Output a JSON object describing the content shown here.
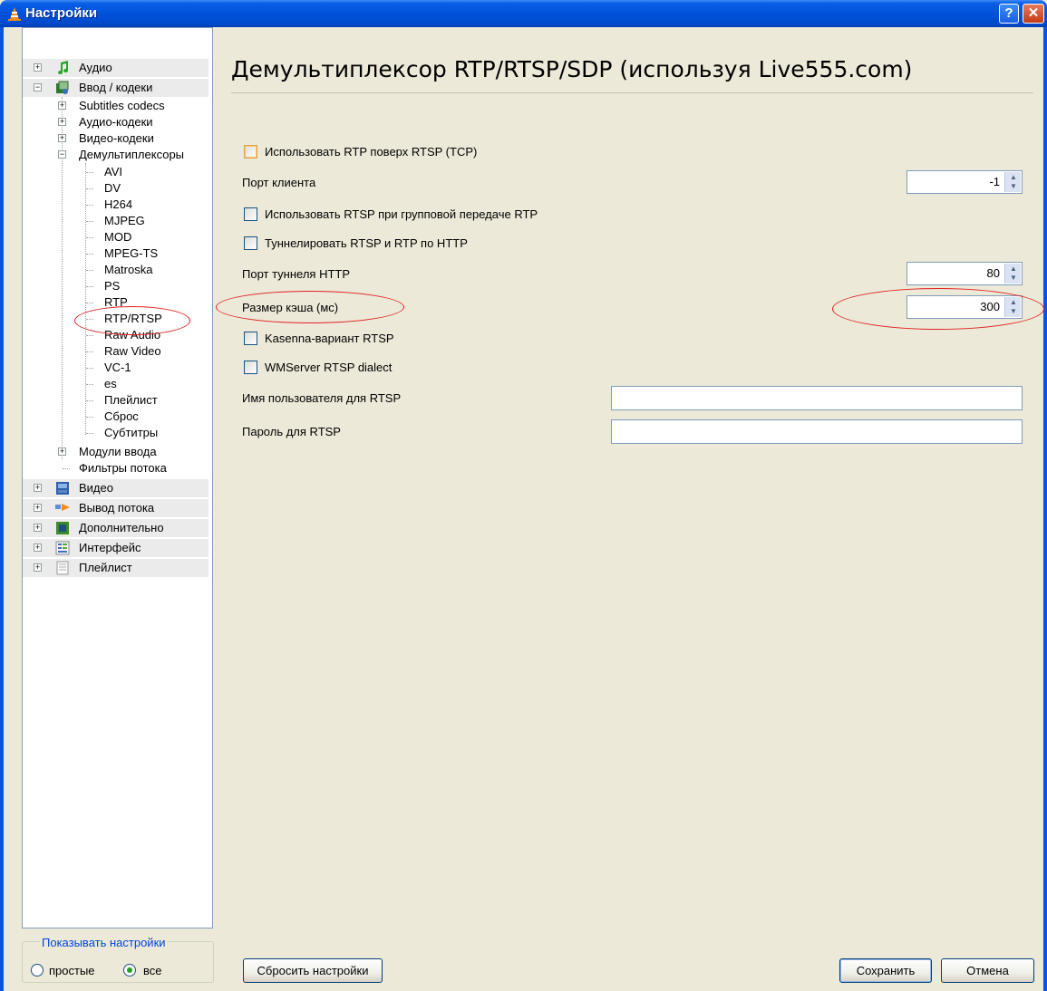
{
  "window": {
    "title": "Настройки",
    "help_glyph": "?",
    "close_glyph": "✕"
  },
  "tree": {
    "audio": "Аудио",
    "input_codecs": "Ввод / кодеки",
    "subtitles_codecs": "Subtitles codecs",
    "audio_codecs": "Аудио-кодеки",
    "video_codecs": "Видео-кодеки",
    "demuxers": "Демультиплексоры",
    "demuxer_items": [
      "AVI",
      "DV",
      "H264",
      "MJPEG",
      "MOD",
      "MPEG-TS",
      "Matroska",
      "PS",
      "RTP",
      "RTP/RTSP",
      "Raw Audio",
      "Raw Video",
      "VC-1",
      "es",
      "Плейлист",
      "Сброс",
      "Субтитры"
    ],
    "input_modules": "Модули ввода",
    "stream_filters": "Фильтры потока",
    "video": "Видео",
    "stream_output": "Вывод потока",
    "advanced": "Дополнительно",
    "interface": "Интерфейс",
    "playlist": "Плейлист"
  },
  "show_settings": {
    "title": "Показывать настройки",
    "simple": "простые",
    "all": "все",
    "selected": "все"
  },
  "panel": {
    "heading": "Демультиплексор RTP/RTSP/SDP (используя Live555.com)",
    "rtp_over_rtsp": "Использовать RTP поверх RTSP (TCP)",
    "client_port_label": "Порт клиента",
    "client_port_value": "-1",
    "rtsp_multicast": "Использовать RTSP при групповой передаче RTP",
    "tunnel_http": "Туннелировать RTSP и RTP по HTTP",
    "http_tunnel_port_label": "Порт туннеля HTTP",
    "http_tunnel_port_value": "80",
    "cache_size_label": "Размер кэша (мс)",
    "cache_size_value": "300",
    "kasenna": "Kasenna-вариант RTSP",
    "wmserver": "WMServer RTSP dialect",
    "rtsp_user_label": "Имя пользователя для RTSP",
    "rtsp_password_label": "Пароль для RTSP"
  },
  "buttons": {
    "reset": "Сбросить настройки",
    "save": "Сохранить",
    "cancel": "Отмена"
  }
}
